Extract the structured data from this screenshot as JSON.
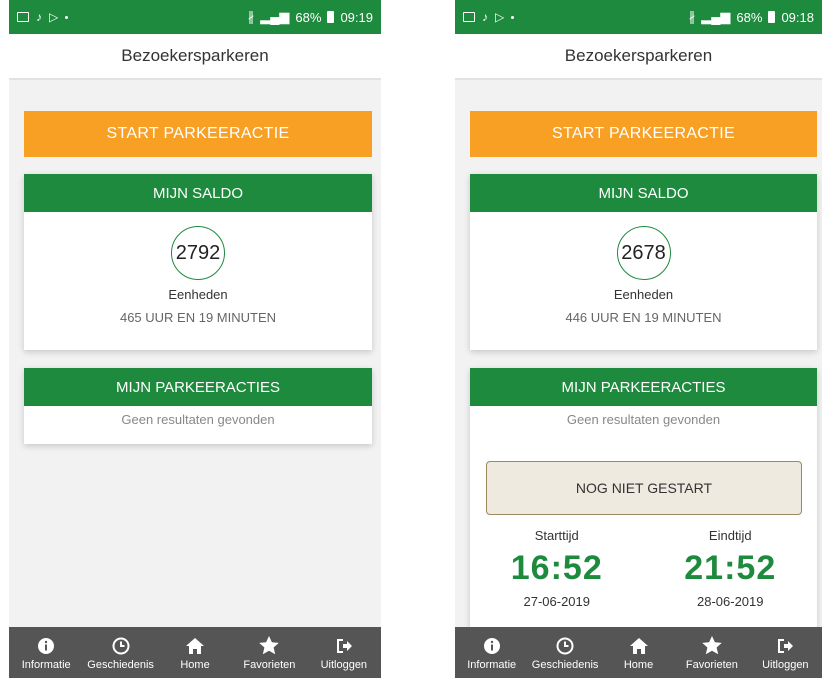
{
  "colors": {
    "brand_green": "#1e8a3d",
    "accent_orange": "#f7a024",
    "tabbar": "#555555"
  },
  "screens": [
    {
      "status": {
        "right_text": "68%",
        "time": "09:19"
      },
      "header_title": "Bezoekersparkeren",
      "start_button": "START PARKEERACTIE",
      "saldo": {
        "title": "MIJN SALDO",
        "value": "2792",
        "unit": "Eenheden",
        "duration": "465 UUR EN 19 MINUTEN"
      },
      "acties": {
        "title": "MIJN PARKEERACTIES",
        "empty": "Geen resultaten gevonden"
      },
      "tabs": [
        {
          "label": "Informatie",
          "icon": "info-icon"
        },
        {
          "label": "Geschiedenis",
          "icon": "clock-icon"
        },
        {
          "label": "Home",
          "icon": "home-icon"
        },
        {
          "label": "Favorieten",
          "icon": "star-icon"
        },
        {
          "label": "Uitloggen",
          "icon": "logout-icon"
        }
      ]
    },
    {
      "status": {
        "right_text": "68%",
        "time": "09:18"
      },
      "header_title": "Bezoekersparkeren",
      "start_button": "START PARKEERACTIE",
      "saldo": {
        "title": "MIJN SALDO",
        "value": "2678",
        "unit": "Eenheden",
        "duration": "446 UUR EN 19 MINUTEN"
      },
      "acties": {
        "title": "MIJN PARKEERACTIES",
        "empty": "Geen resultaten gevonden",
        "session": {
          "status_button": "NOG NIET GESTART",
          "start_label": "Starttijd",
          "start_time": "16:52",
          "start_date": "27-06-2019",
          "end_label": "Eindtijd",
          "end_time": "21:52",
          "end_date": "28-06-2019"
        }
      },
      "tabs": [
        {
          "label": "Informatie",
          "icon": "info-icon"
        },
        {
          "label": "Geschiedenis",
          "icon": "clock-icon"
        },
        {
          "label": "Home",
          "icon": "home-icon"
        },
        {
          "label": "Favorieten",
          "icon": "star-icon"
        },
        {
          "label": "Uitloggen",
          "icon": "logout-icon"
        }
      ]
    }
  ]
}
